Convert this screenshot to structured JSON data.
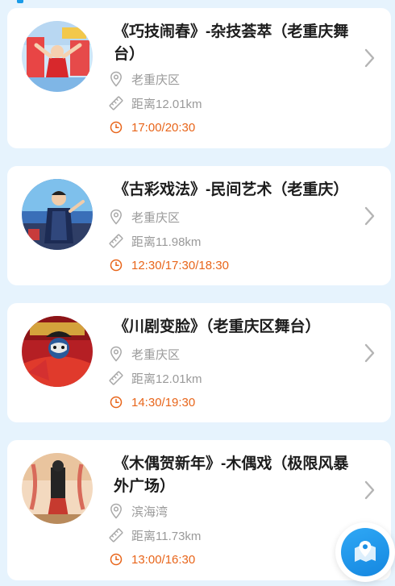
{
  "colors": {
    "accent": "#1a9be8",
    "time": "#e8651a",
    "muted": "#9a9a9a",
    "title": "#1c1c1c",
    "background": "#e6f3fd"
  },
  "shows": [
    {
      "title": "《巧技闹春》-杂技荟萃（老重庆舞台）",
      "location": "老重庆区",
      "distance": "距离12.01km",
      "times": "17:00/20:30",
      "thumb_icon": "acrobatics-photo"
    },
    {
      "title": "《古彩戏法》-民间艺术（老重庆）",
      "location": "老重庆区",
      "distance": "距离11.98km",
      "times": "12:30/17:30/18:30",
      "thumb_icon": "magician-photo"
    },
    {
      "title": "《川剧变脸》（老重庆区舞台）",
      "location": "老重庆区",
      "distance": "距离12.01km",
      "times": "14:30/19:30",
      "thumb_icon": "face-changing-photo"
    },
    {
      "title": "《木偶贺新年》-木偶戏（极限风暴外广场）",
      "location": "滨海湾",
      "distance": "距离11.73km",
      "times": "13:00/16:30",
      "thumb_icon": "puppet-photo"
    }
  ],
  "fab": {
    "icon": "map-location-icon"
  }
}
